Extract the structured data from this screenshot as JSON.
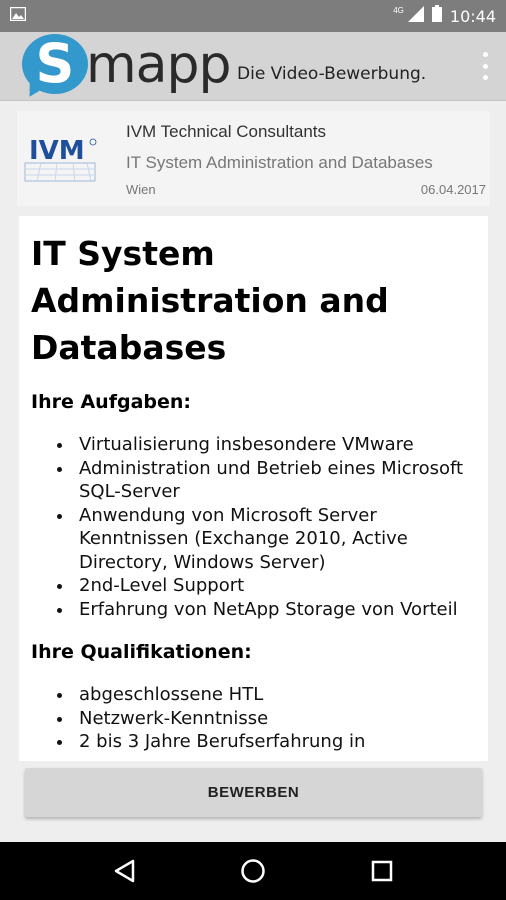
{
  "status_bar": {
    "time": "10:44",
    "network": "4G"
  },
  "app_bar": {
    "logo_letter": "S",
    "logo_rest": "mapp",
    "tagline": "Die Video-Bewerbung.",
    "menu_icon": "overflow-menu-icon"
  },
  "job": {
    "company_logo_text": "IVM",
    "company": "IVM Technical Consultants",
    "subtitle": "IT System Administration and Databases",
    "location": "Wien",
    "date": "06.04.2017"
  },
  "description": {
    "title": "IT System Administration and Databases",
    "sections": [
      {
        "heading": "Ihre Aufgaben:",
        "items": [
          "Virtualisierung insbesondere VMware",
          "Administration und Betrieb eines Microsoft SQL-Server",
          "Anwendung von Microsoft Server Kenntnissen (Exchange 2010, Active Directory, Windows Server)",
          "2nd-Level Support",
          "Erfahrung von NetApp Storage von Vorteil"
        ]
      },
      {
        "heading": "Ihre Qualifikationen:",
        "items": [
          "abgeschlossene HTL",
          "Netzwerk-Kenntnisse",
          "2 bis 3 Jahre Berufserfahrung in"
        ]
      }
    ]
  },
  "apply_button": {
    "label": "BEWERBEN"
  },
  "colors": {
    "accent": "#3399cc",
    "status_bar": "#7d7d7d",
    "app_bar": "#d4d4d4"
  }
}
